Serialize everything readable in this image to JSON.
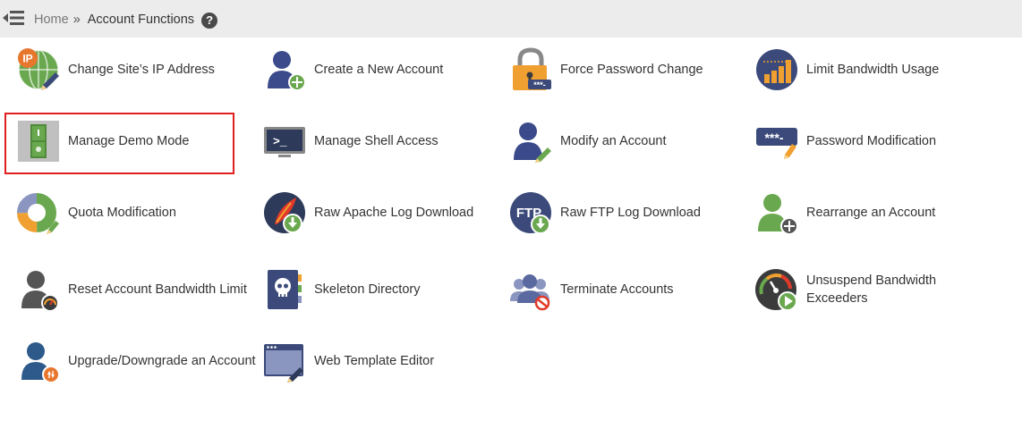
{
  "breadcrumb": {
    "home": "Home",
    "separator": "»",
    "current": "Account Functions",
    "help_glyph": "?"
  },
  "colors": {
    "topbar_bg": "#ececec",
    "highlight_border": "#e02020",
    "icon_green": "#6aa84f",
    "icon_navy": "#3b4a7a",
    "icon_orange": "#f0a030"
  },
  "functions": [
    {
      "label": "Change Site’s IP Address",
      "icon": "ip-globe-icon",
      "ip_badge": "IP"
    },
    {
      "label": "Create a New Account",
      "icon": "add-user-icon"
    },
    {
      "label": "Force Password Change",
      "icon": "padlock-icon",
      "password_mask": "***-"
    },
    {
      "label": "Limit Bandwidth Usage",
      "icon": "bandwidth-bars-icon"
    },
    {
      "label": "Manage Demo Mode",
      "icon": "demo-switch-icon"
    },
    {
      "label": "Manage Shell Access",
      "icon": "terminal-icon",
      "prompt": ">_"
    },
    {
      "label": "Modify an Account",
      "icon": "edit-user-icon"
    },
    {
      "label": "Password Modification",
      "icon": "password-field-icon",
      "password_mask": "***-"
    },
    {
      "label": "Quota Modification",
      "icon": "quota-donut-icon"
    },
    {
      "label": "Raw Apache Log Download",
      "icon": "apache-feather-icon"
    },
    {
      "label": "Raw FTP Log Download",
      "icon": "ftp-download-icon",
      "ftp_text": "FTP"
    },
    {
      "label": "Rearrange an Account",
      "icon": "rearrange-user-icon"
    },
    {
      "label": "Reset Account Bandwidth Limit",
      "icon": "reset-bandwidth-user-icon"
    },
    {
      "label": "Skeleton Directory",
      "icon": "skull-book-icon"
    },
    {
      "label": "Terminate Accounts",
      "icon": "terminate-users-icon"
    },
    {
      "label": "Unsuspend Bandwidth Exceeders",
      "icon": "gauge-play-icon"
    },
    {
      "label": "Upgrade/Downgrade an Account",
      "icon": "upgrade-user-icon"
    },
    {
      "label": "Web Template Editor",
      "icon": "template-editor-icon"
    }
  ]
}
